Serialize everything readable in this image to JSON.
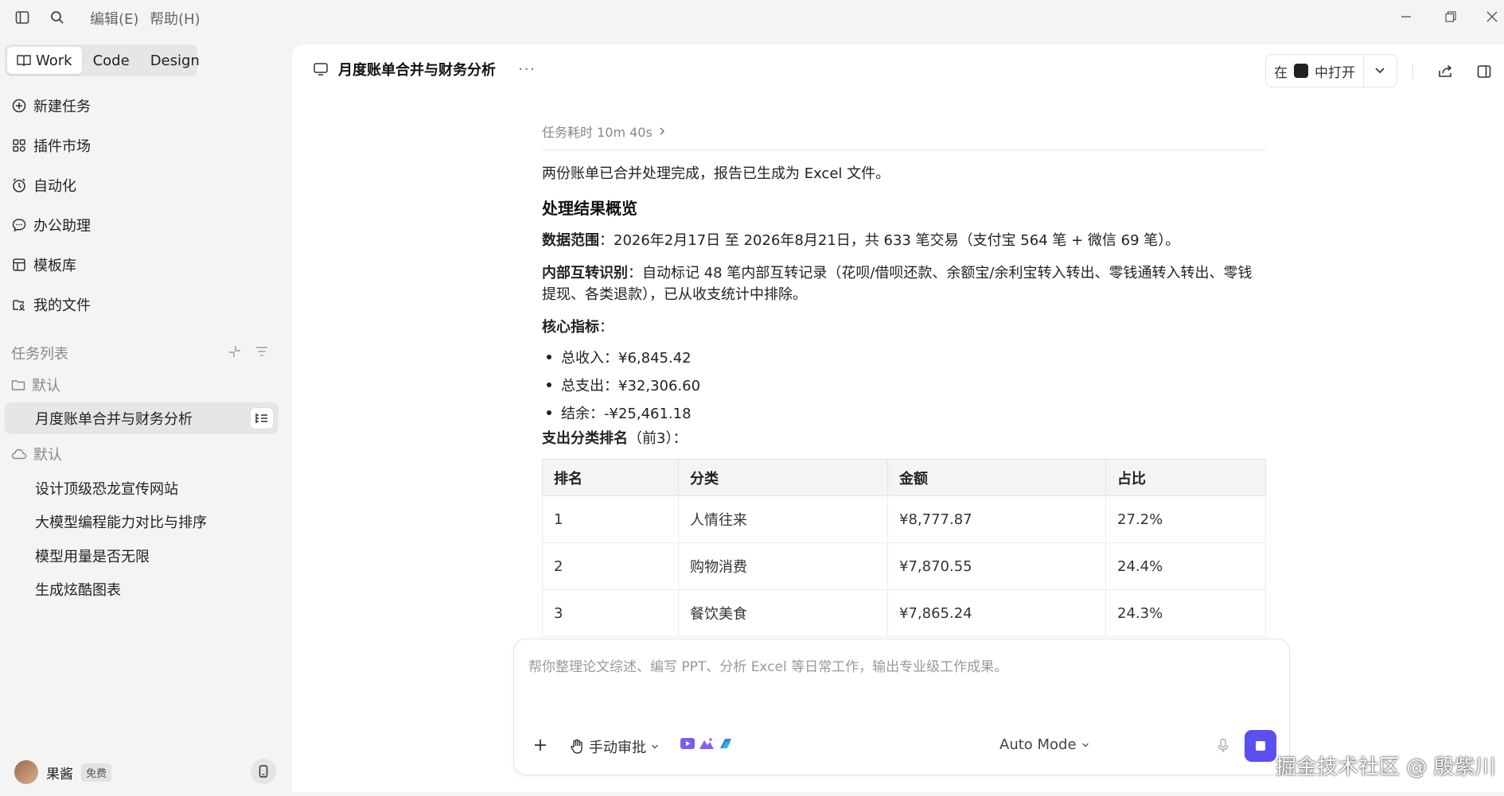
{
  "menu": {
    "edit": "编辑(E)",
    "help": "帮助(H)"
  },
  "modes": [
    {
      "label": "Work",
      "active": true
    },
    {
      "label": "Code",
      "active": false
    },
    {
      "label": "Design",
      "active": false
    }
  ],
  "nav": [
    {
      "label": "新建任务",
      "icon": "new-task-icon"
    },
    {
      "label": "插件市场",
      "icon": "plugin-icon"
    },
    {
      "label": "自动化",
      "icon": "clock-icon"
    },
    {
      "label": "办公助理",
      "icon": "chat-icon"
    },
    {
      "label": "模板库",
      "icon": "template-icon"
    },
    {
      "label": "我的文件",
      "icon": "files-icon"
    }
  ],
  "task_list": {
    "title": "任务列表",
    "local_group": {
      "label": "默认",
      "items": [
        "月度账单合并与财务分析"
      ]
    },
    "cloud_group": {
      "label": "默认",
      "items": [
        "设计顶级恐龙宣传网站",
        "大模型编程能力对比与排序",
        "模型用量是否无限",
        "生成炫酷图表"
      ]
    }
  },
  "user": {
    "name": "果酱",
    "plan": "免费"
  },
  "header": {
    "title": "月度账单合并与财务分析",
    "more": "···",
    "open_in_prefix": "在",
    "open_in_suffix": "中打开"
  },
  "content": {
    "duration": "任务耗时 10m 40s",
    "intro": "两份账单已合并处理完成，报告已生成为 Excel 文件。",
    "overview_title": "处理结果概览",
    "range_label": "数据范围",
    "range_text": "：2026年2月17日 至 2026年8月21日，共 633 笔交易（支付宝 564 笔 + 微信 69 笔）。",
    "transfer_label": "内部互转识别",
    "transfer_text": "：自动标记 48 笔内部互转记录（花呗/借呗还款、余额宝/余利宝转入转出、零钱通转入转出、零钱提现、各类退款），已从收支统计中排除。",
    "kpi_label": "核心指标",
    "kpi_colon": "：",
    "metrics": [
      "总收入：¥6,845.42",
      "总支出：¥32,306.60",
      "结余：-¥25,461.18"
    ],
    "ranking_label": "支出分类排名",
    "ranking_suffix": "（前3）：",
    "table": {
      "headers": [
        "排名",
        "分类",
        "金额",
        "占比"
      ],
      "rows": [
        [
          "1",
          "人情往来",
          "¥8,777.87",
          "27.2%"
        ],
        [
          "2",
          "购物消费",
          "¥7,870.55",
          "24.4%"
        ],
        [
          "3",
          "餐饮美食",
          "¥7,865.24",
          "24.3%"
        ]
      ]
    }
  },
  "composer": {
    "placeholder": "帮你整理论文综述、编写 PPT、分析 Excel 等日常工作，输出专业级工作成果。",
    "approval": "手动审批",
    "mode": "Auto Mode"
  },
  "watermark": "掘金技术社区 @ 殷紫川"
}
